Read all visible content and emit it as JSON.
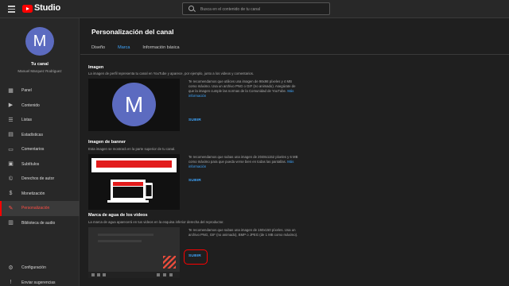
{
  "header": {
    "app_name": "Studio",
    "search_placeholder": "Busca en el contenido de tu canal"
  },
  "channel": {
    "avatar_letter": "M",
    "title": "Tu canal",
    "owner": "Manuel Marquez Rodriguez"
  },
  "sidebar": {
    "items": [
      {
        "label": "Panel",
        "icon": "dashboard-icon"
      },
      {
        "label": "Contenido",
        "icon": "content-icon"
      },
      {
        "label": "Listas",
        "icon": "playlists-icon"
      },
      {
        "label": "Estadísticas",
        "icon": "analytics-icon"
      },
      {
        "label": "Comentarios",
        "icon": "comments-icon"
      },
      {
        "label": "Subtítulos",
        "icon": "subtitles-icon"
      },
      {
        "label": "Derechos de autor",
        "icon": "copyright-icon"
      },
      {
        "label": "Monetización",
        "icon": "monetization-icon"
      },
      {
        "label": "Personalización",
        "icon": "customization-icon",
        "active": true
      },
      {
        "label": "Biblioteca de audio",
        "icon": "audio-library-icon"
      }
    ],
    "bottom_items": [
      {
        "label": "Configuración",
        "icon": "settings-icon"
      },
      {
        "label": "Enviar sugerencias",
        "icon": "feedback-icon"
      }
    ]
  },
  "page": {
    "title": "Personalización del canal",
    "tabs": [
      {
        "label": "Diseño"
      },
      {
        "label": "Marca",
        "active": true
      },
      {
        "label": "Información básica"
      }
    ]
  },
  "sections": {
    "image": {
      "title": "Imagen",
      "desc": "La imagen de perfil representa tu canal en YouTube y aparece, por ejemplo, junto a los videos y comentarios.",
      "info": "Te recomendamos que utilices una imagen de 98x98 píxeles y 4 MB como máximo. Usa un archivo PNG o GIF (no animado). Asegúrate de que la imagen cumple las normas de la Comunidad de YouTube.",
      "link": "Más información",
      "upload": "SUBIR"
    },
    "banner": {
      "title": "Imagen de banner",
      "desc": "Esta imagen se mostrará en la parte superior de tu canal.",
      "info": "Te recomendamos que subas una imagen de 2048x1152 píxeles y 6 MB como máximo para que pueda verse bien en todas las pantallas.",
      "link": "Más información",
      "upload": "SUBIR"
    },
    "watermark": {
      "title": "Marca de agua de los videos",
      "desc": "La marca de agua aparecerá en tus videos en la esquina inferior derecha del reproductor.",
      "info": "Te recomendamos que subas una imagen de 150x150 píxeles. Usa un archivo PNG, GIF (no animado), BMP o JPEG (de 1 MB como máximo).",
      "upload": "SUBIR"
    }
  },
  "colors": {
    "accent": "#3ea6ff",
    "brand": "#ff0000",
    "avatar": "#5c6bc0"
  }
}
